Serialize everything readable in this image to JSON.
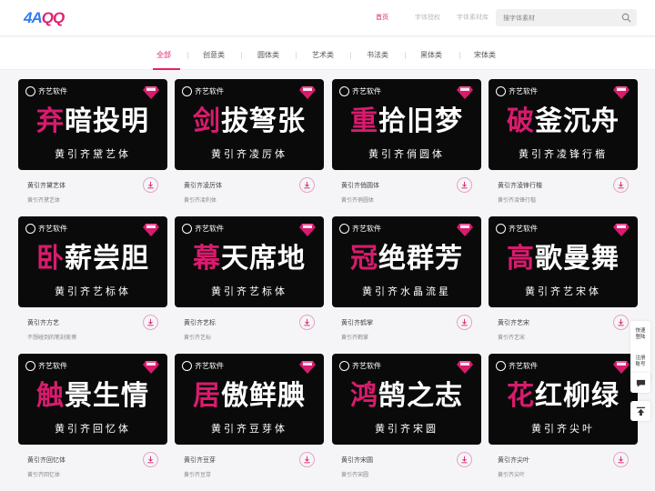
{
  "header": {
    "logo_left": "4A",
    "logo_right": "QQ",
    "nav": [
      {
        "label": "首页"
      },
      {
        "label": "字体授权"
      },
      {
        "label": "字体素材库"
      }
    ],
    "search": {
      "placeholder": "搜字体素材"
    }
  },
  "categories": [
    "全部",
    "创意类",
    "圆体类",
    "艺术类",
    "书法类",
    "黑体类",
    "宋体类"
  ],
  "cards": [
    {
      "brand": "齐艺软件",
      "preview_hl": "弃",
      "preview_rest": "暗投明",
      "sub": "黄引齐黛艺体",
      "title": "黄引齐黛艺体",
      "desc": "黄引齐黛艺体"
    },
    {
      "brand": "齐艺软件",
      "preview_hl": "剑",
      "preview_rest": "拔弩张",
      "sub": "黄引齐凌厉体",
      "title": "黄引齐凌厉体",
      "desc": "黄引齐凌利体"
    },
    {
      "brand": "齐艺软件",
      "preview_hl": "重",
      "preview_rest": "拾旧梦",
      "sub": "黄引齐俏圆体",
      "title": "黄引齐俏圆体",
      "desc": "黄引齐俏圆体"
    },
    {
      "brand": "齐艺软件",
      "preview_hl": "破",
      "preview_rest": "釜沉舟",
      "sub": "黄引齐凌锋行楷",
      "title": "黄引齐凌锋行楷",
      "desc": "黄引齐凌锋行楷"
    },
    {
      "brand": "齐艺软件",
      "preview_hl": "卧",
      "preview_rest": "薪尝胆",
      "sub": "黄引齐艺标体",
      "title": "黄引齐方艺",
      "desc": "不想碰到的笔刻美博"
    },
    {
      "brand": "齐艺软件",
      "preview_hl": "幕",
      "preview_rest": "天席地",
      "sub": "黄引齐艺标体",
      "title": "黄引齐艺标",
      "desc": "黄引齐艺标"
    },
    {
      "brand": "齐艺软件",
      "preview_hl": "冠",
      "preview_rest": "绝群芳",
      "sub": "黄引齐水晶流星",
      "title": "黄引齐鹤掌",
      "desc": "黄引齐鹤掌"
    },
    {
      "brand": "齐艺软件",
      "preview_hl": "高",
      "preview_rest": "歌曼舞",
      "sub": "黄引齐艺宋体",
      "title": "黄引齐艺宋",
      "desc": "黄引齐艺宋"
    },
    {
      "brand": "齐艺软件",
      "preview_hl": "触",
      "preview_rest": "景生情",
      "sub": "黄引齐回忆体",
      "title": "黄引齐回忆体",
      "desc": "黄引齐回忆体"
    },
    {
      "brand": "齐艺软件",
      "preview_hl": "居",
      "preview_rest": "傲鲜腆",
      "sub": "黄引齐豆芽体",
      "title": "黄引齐豆芽",
      "desc": "黄引齐豆芽"
    },
    {
      "brand": "齐艺软件",
      "preview_hl": "鸿",
      "preview_rest": "鹄之志",
      "sub": "黄引齐宋圆",
      "title": "黄引齐宋圆",
      "desc": "黄引齐宋圆"
    },
    {
      "brand": "齐艺软件",
      "preview_hl": "花",
      "preview_rest": "红柳绿",
      "sub": "黄引齐尖叶",
      "title": "黄引齐尖叶",
      "desc": "黄引齐尖叶"
    }
  ],
  "float_tools": {
    "quick_login": "快速登陆",
    "register": "注册账号"
  },
  "colors": {
    "accent": "#e0226e",
    "brand_blue": "#2f7df0",
    "card_bg": "#0a0a0a"
  }
}
